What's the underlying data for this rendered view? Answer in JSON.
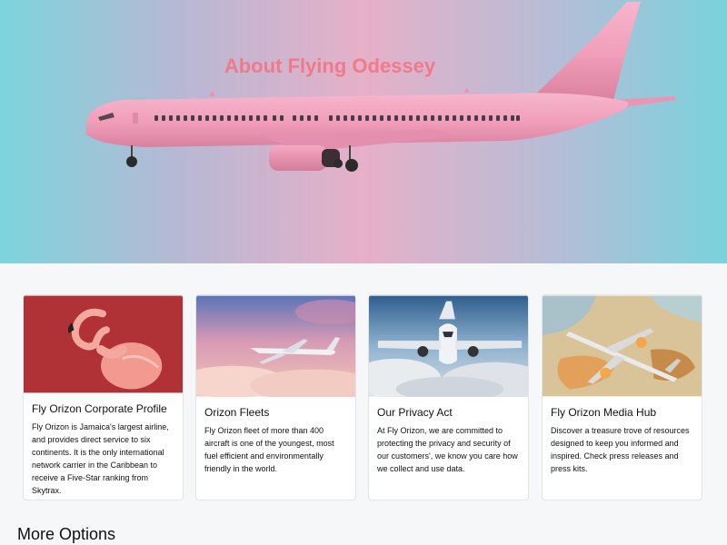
{
  "hero": {
    "title": "About Flying Odessey"
  },
  "cards": [
    {
      "title": "Fly Orizon Corporate Profile",
      "text": "Fly Orizon is Jamaica's largest airline, and provides direct service to six continents. It is the only international network carrier in the Caribbean to receive a Five-Star ranking from Skytrax.",
      "image": "flamingo-image"
    },
    {
      "title": "Orizon Fleets",
      "text": "Fly Orizon fleet of more than 400 aircraft is one of the youngest, most fuel efficient and environmentally friendly in the world.",
      "image": "plane-sunset-image"
    },
    {
      "title": "Our Privacy Act",
      "text": "At Fly Orizon, we are committed to protecting the privacy and security of our customers', we know you care how we collect and use data.",
      "image": "plane-clouds-image"
    },
    {
      "title": "Fly Orizon Media Hub",
      "text": "Discover a treasure trove of resources designed to keep you informed and inspired. Check press releases and press kits.",
      "image": "plane-map-image"
    }
  ],
  "more_options": {
    "heading": "More Options"
  },
  "colors": {
    "hero_title": "#f07a8a",
    "plane_body": "#f2a3bd",
    "card_border": "#e2e4e8",
    "page_bg": "#f6f7f9"
  }
}
